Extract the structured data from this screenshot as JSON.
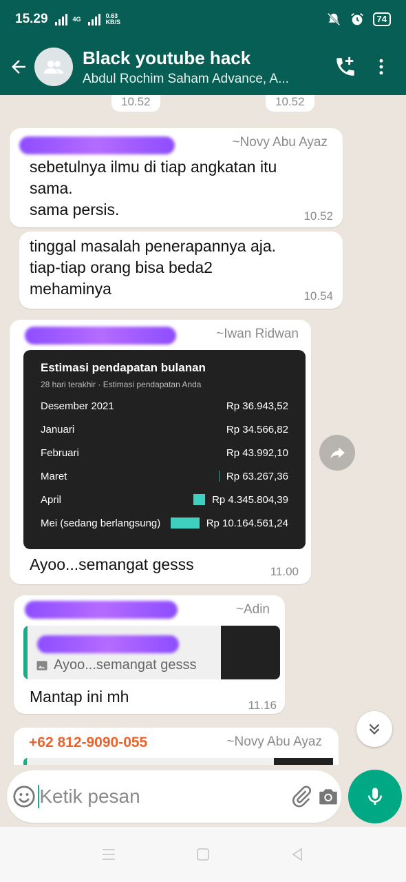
{
  "status_bar": {
    "time": "15.29",
    "net_type": "4G",
    "net_speed": "0.63",
    "net_unit": "KB/S",
    "battery": "74"
  },
  "header": {
    "title": "Black youtube hack",
    "subtitle": "Abdul Rochim Saham Advance, A..."
  },
  "chat": {
    "top_times": [
      "10.52",
      "10.52"
    ],
    "messages": [
      {
        "sender": "~Novy Abu Ayaz",
        "text_lines": [
          "sebetulnya ilmu di tiap angkatan itu",
          "sama.",
          "sama persis."
        ],
        "time": "10.52"
      },
      {
        "text_lines": [
          "tinggal masalah penerapannya aja.",
          "tiap-tiap orang bisa beda2",
          "mehaminya"
        ],
        "time": "10.54"
      },
      {
        "sender": "~Iwan Ridwan",
        "caption": "Ayoo...semangat gesss",
        "time": "11.00",
        "card": {
          "title": "Estimasi pendapatan bulanan",
          "subtitle": "28 hari terakhir · Estimasi pendapatan Anda",
          "rows": [
            {
              "month": "Desember 2021",
              "amount": "Rp 36.943,52",
              "bar_fraction": 0
            },
            {
              "month": "Januari",
              "amount": "Rp 34.566,82",
              "bar_fraction": 0
            },
            {
              "month": "Februari",
              "amount": "Rp 43.992,10",
              "bar_fraction": 0
            },
            {
              "month": "Maret",
              "amount": "Rp 63.267,36",
              "bar_fraction": 0.01
            },
            {
              "month": "April",
              "amount": "Rp 4.345.804,39",
              "bar_fraction": 0.43
            },
            {
              "month": "Mei (sedang berlangsung)",
              "amount": "Rp 10.164.561,24",
              "bar_fraction": 1
            }
          ]
        }
      },
      {
        "sender": "~Adin",
        "quote_text": "Ayoo...semangat gesss",
        "text": "Mantap ini mh",
        "time": "11.16"
      },
      {
        "phone": "+62 812-9090-055",
        "sender": "~Novy Abu Ayaz"
      }
    ]
  },
  "composer": {
    "placeholder": "Ketik pesan"
  },
  "colors": {
    "header_bg": "#075e54",
    "chat_bg": "#ece5dd",
    "accent": "#00a884",
    "bar": "#3fd0c0",
    "phone_orange": "#e8642c"
  }
}
